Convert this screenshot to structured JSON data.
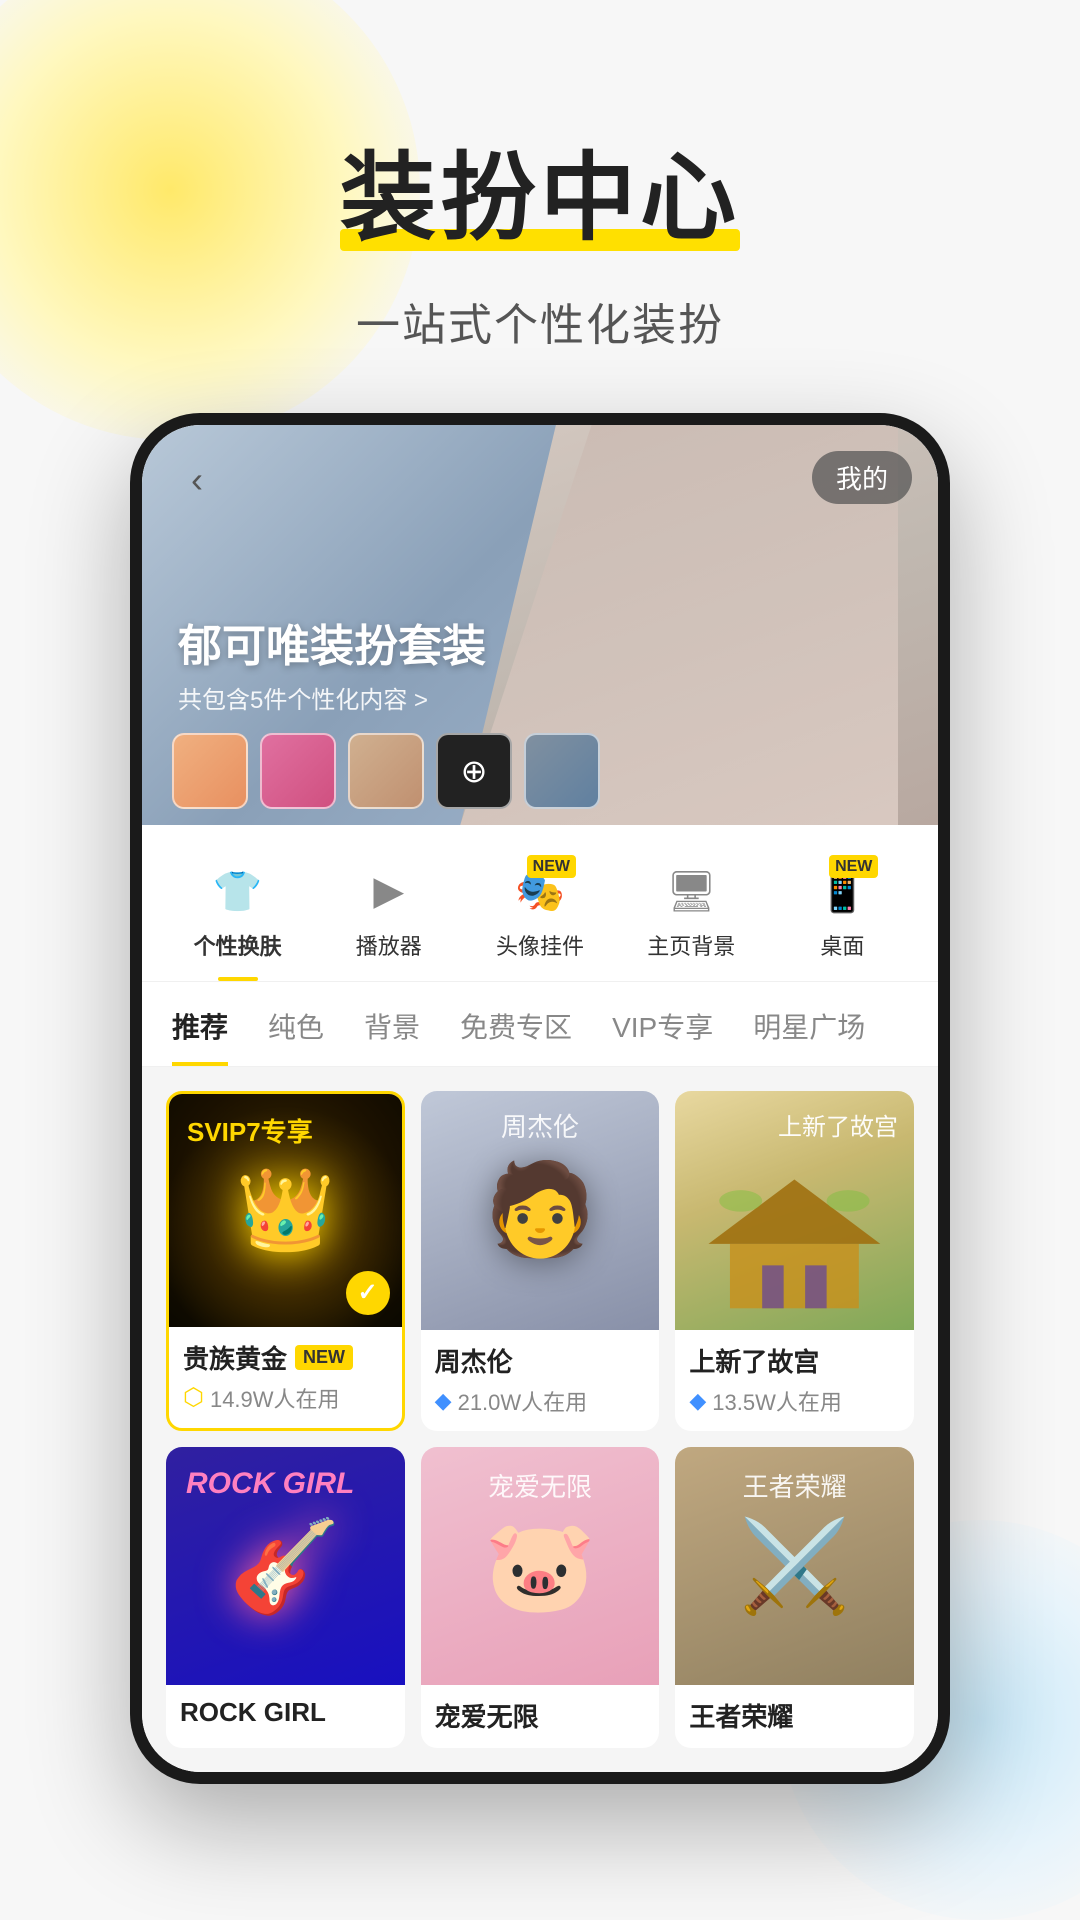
{
  "page": {
    "background": {
      "blob_yellow": "yellow gradient blob top left",
      "blob_blue": "blue gradient blob bottom right"
    },
    "header": {
      "main_title": "装扮中心",
      "subtitle": "一站式个性化装扮"
    },
    "phone": {
      "hero": {
        "back_label": "‹",
        "my_label": "我的",
        "title": "郁可唯装扮套装",
        "subtitle": "共包含5件个性化内容 >"
      },
      "category_tabs": [
        {
          "id": "skin",
          "icon": "👕",
          "label": "个性换肤",
          "active": true,
          "new": false,
          "icon_color": "blue"
        },
        {
          "id": "player",
          "icon": "▶",
          "label": "播放器",
          "active": false,
          "new": false,
          "icon_color": "gray"
        },
        {
          "id": "avatar",
          "icon": "🎭",
          "label": "头像挂件",
          "active": false,
          "new": true,
          "icon_color": "gray"
        },
        {
          "id": "homebg",
          "icon": "🖥",
          "label": "主页背景",
          "active": false,
          "new": false,
          "icon_color": "gray"
        },
        {
          "id": "desktop",
          "icon": "📱",
          "label": "桌面",
          "active": false,
          "new": true,
          "icon_color": "gray"
        }
      ],
      "filter_tabs": [
        {
          "id": "recommend",
          "label": "推荐",
          "active": true
        },
        {
          "id": "solid",
          "label": "纯色",
          "active": false
        },
        {
          "id": "scene",
          "label": "背景",
          "active": false
        },
        {
          "id": "free",
          "label": "免费专区",
          "active": false
        },
        {
          "id": "vip",
          "label": "VIP专享",
          "active": false
        },
        {
          "id": "star",
          "label": "明星广场",
          "active": false
        }
      ],
      "skin_cards": [
        {
          "id": "guizu",
          "name": "贵族黄金",
          "badge": "NEW",
          "users": "14.9W人在用",
          "coin_type": "gold",
          "selected": true,
          "svip_text": "SVIP7专享",
          "type": "svip"
        },
        {
          "id": "jay",
          "name": "周杰伦",
          "badge": "",
          "users": "21.0W人在用",
          "coin_type": "diamond",
          "selected": false,
          "type": "jay"
        },
        {
          "id": "palace",
          "name": "上新了故宫",
          "badge": "",
          "users": "13.5W人在用",
          "coin_type": "diamond",
          "selected": false,
          "type": "palace"
        },
        {
          "id": "rockgirl",
          "name": "ROCK GIRL",
          "badge": "",
          "users": "",
          "coin_type": "none",
          "selected": false,
          "type": "rockgirl"
        },
        {
          "id": "pet",
          "name": "宠爱无限",
          "badge": "",
          "users": "",
          "coin_type": "none",
          "selected": false,
          "type": "pet"
        },
        {
          "id": "wzry",
          "name": "王者荣耀",
          "badge": "",
          "users": "",
          "coin_type": "none",
          "selected": false,
          "type": "wzry"
        }
      ]
    }
  }
}
